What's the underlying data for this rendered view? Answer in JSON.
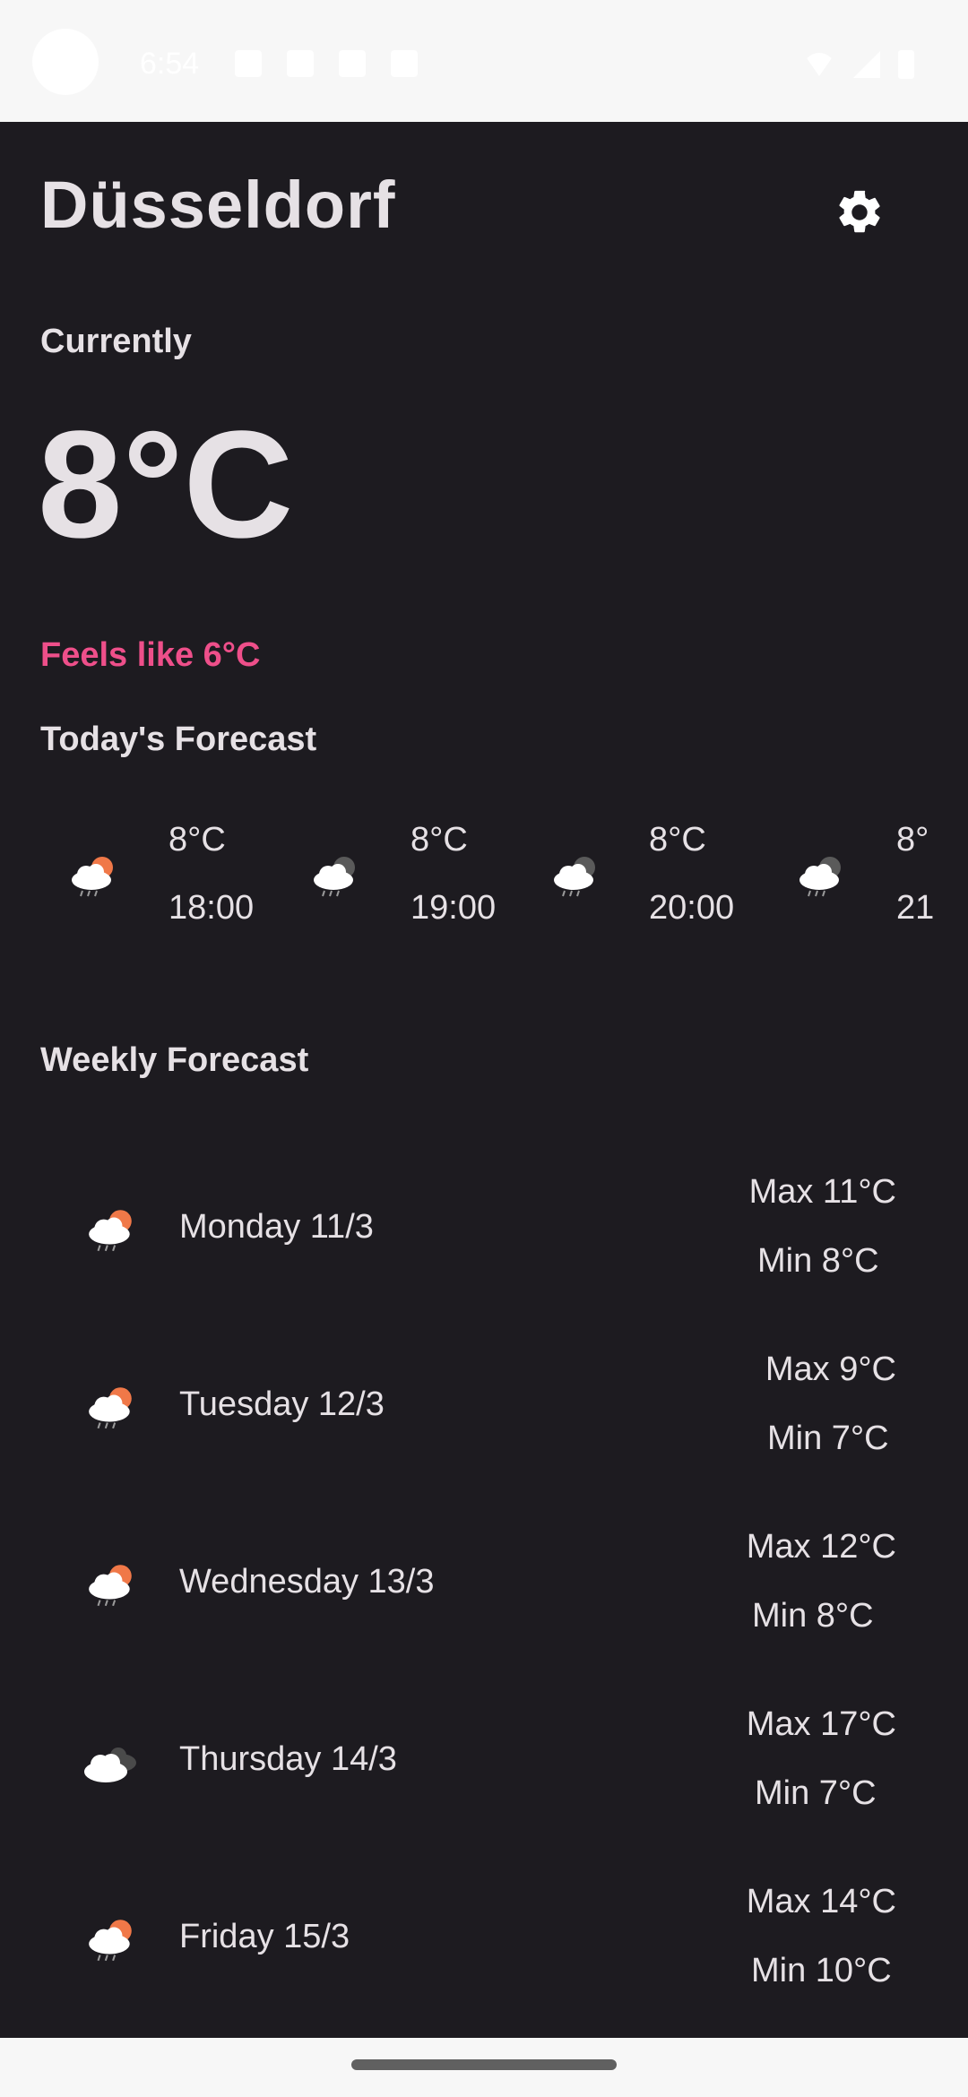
{
  "status_bar": {
    "time": "6:54"
  },
  "header": {
    "city": "Düsseldorf",
    "settings_icon": "gear-icon"
  },
  "current": {
    "label": "Currently",
    "temperature": "8°C",
    "feels_like": "Feels like 6°C"
  },
  "today": {
    "label": "Today's Forecast",
    "hours": [
      {
        "temp": "8°C",
        "time": "18:00",
        "icon": "cloud-sun-rain-icon"
      },
      {
        "temp": "8°C",
        "time": "19:00",
        "icon": "cloud-moon-rain-icon"
      },
      {
        "temp": "8°C",
        "time": "20:00",
        "icon": "cloud-moon-rain-icon"
      },
      {
        "temp": "8°",
        "time": "21",
        "icon": "cloud-moon-rain-icon"
      }
    ]
  },
  "weekly": {
    "label": "Weekly Forecast",
    "days": [
      {
        "day": "Monday 11/3",
        "max": "Max 11°C",
        "min": "Min 8°C",
        "icon": "cloud-sun-rain-icon"
      },
      {
        "day": "Tuesday 12/3",
        "max": "Max 9°C",
        "min": "Min 7°C",
        "icon": "cloud-sun-rain-icon"
      },
      {
        "day": "Wednesday 13/3",
        "max": "Max 12°C",
        "min": "Min 8°C",
        "icon": "cloud-sun-rain-icon"
      },
      {
        "day": "Thursday 14/3",
        "max": "Max 17°C",
        "min": "Min 7°C",
        "icon": "cloudy-icon"
      },
      {
        "day": "Friday 15/3",
        "max": "Max 14°C",
        "min": "Min 10°C",
        "icon": "cloud-sun-rain-icon"
      }
    ]
  },
  "colors": {
    "background": "#1d1b20",
    "text": "#e6e1e5",
    "accent": "#ee4f8a",
    "sun": "#f07848"
  }
}
